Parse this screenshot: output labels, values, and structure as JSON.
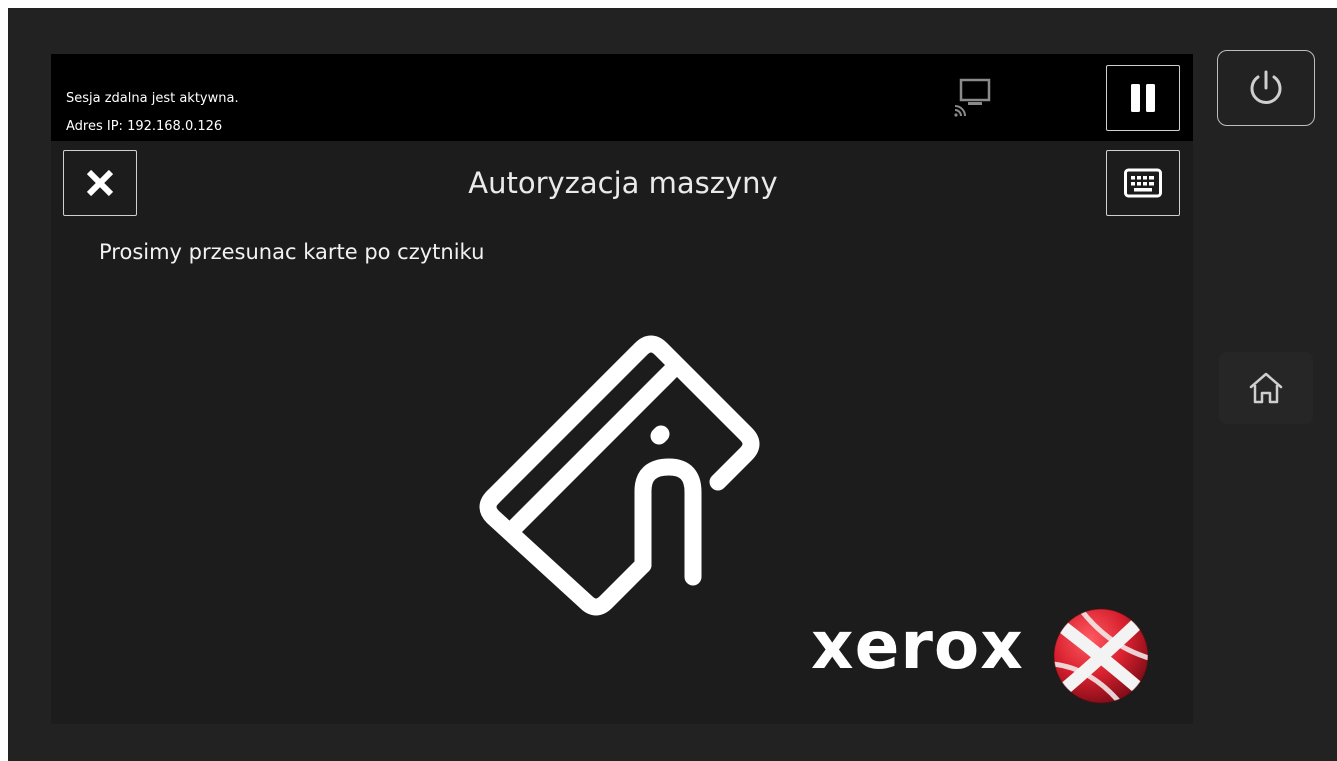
{
  "status_bar": {
    "line1": "Sesja zdalna jest aktywna.",
    "line2": "Adres IP: 192.168.0.126",
    "remote_icon": "remote-session-icon",
    "pause_icon": "pause-icon"
  },
  "dialog": {
    "title": "Autoryzacja maszyny",
    "instruction": "Prosimy przesunac karte po czytniku",
    "close_icon": "close-icon",
    "keyboard_icon": "keyboard-icon",
    "illustration_icon": "card-swipe-icon"
  },
  "branding": {
    "wordmark": "xerox",
    "logo_colors": {
      "red": "#d8202f",
      "white": "#ffffff"
    }
  },
  "hardware_buttons": {
    "power_icon": "power-icon",
    "home_icon": "home-icon"
  },
  "colors": {
    "bezel": "#222222",
    "screen_bg": "#1c1c1c",
    "status_bar_bg": "#000000",
    "text": "#ffffff"
  }
}
